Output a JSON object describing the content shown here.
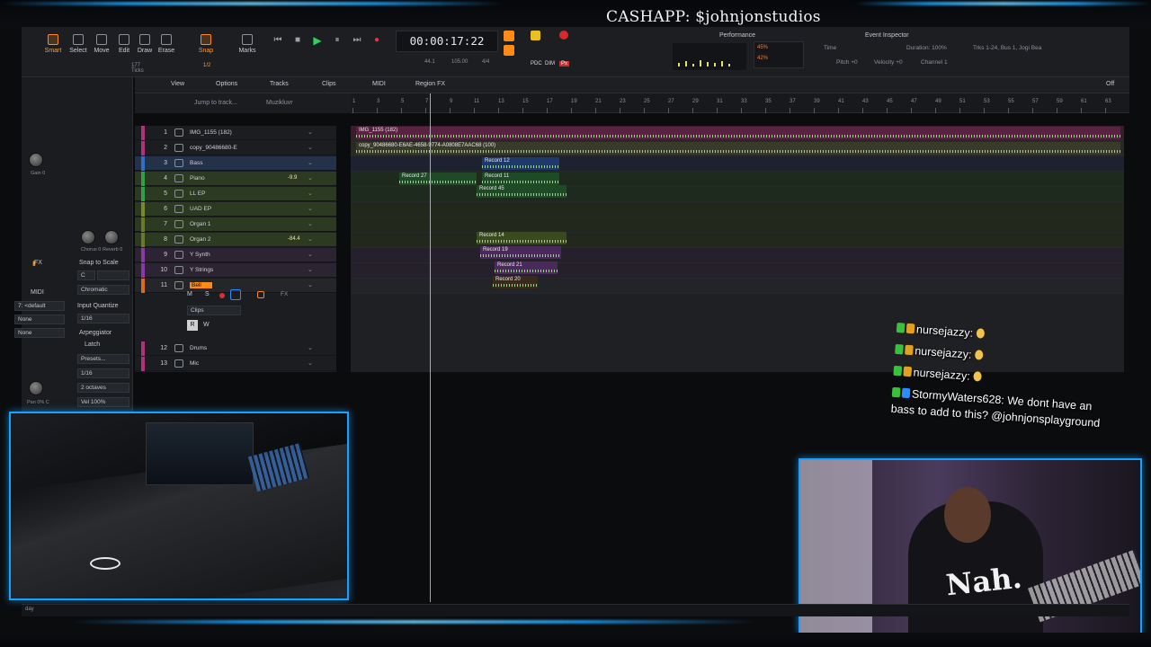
{
  "overlay": {
    "cashapp_text": "CASHAPP: $johnjonstudios"
  },
  "toolbar": {
    "tools": [
      "Smart",
      "Select",
      "Move",
      "Edit",
      "Draw",
      "Erase"
    ],
    "snap_label": "Snap",
    "snap_value": "1/2",
    "marks_label": "Marks",
    "ticks_label": "177 Ticks",
    "timecode": "00:00:17:22",
    "tempo": "105.00",
    "meter": "4/4",
    "bar_display": "44.1",
    "mode_labels": [
      "PDC",
      "DIM",
      "Px",
      "Fx"
    ],
    "performance_label": "Performance",
    "perf_values": [
      "45%",
      "42%"
    ],
    "event_inspector_label": "Event Inspector",
    "inspector_fields": [
      "Time",
      "Duration: 100%",
      "Pitch +0",
      "Velocity +0",
      "Channel 1"
    ],
    "track_info": "Trks 1-24, Bus 1, Jogi Bea"
  },
  "menu": {
    "items": [
      "View",
      "Options",
      "Tracks",
      "Clips",
      "MIDI",
      "Region FX"
    ],
    "off_label": "Off",
    "jump_placeholder": "Jump to track...",
    "workspace_label": "Muzikluvr"
  },
  "ruler_ticks": [
    "1",
    "3",
    "5",
    "7",
    "9",
    "11",
    "13",
    "15",
    "17",
    "19",
    "21",
    "23",
    "25",
    "27",
    "29",
    "31",
    "33",
    "35",
    "37",
    "39",
    "41",
    "43",
    "45",
    "47",
    "49",
    "51",
    "53",
    "55",
    "57",
    "59",
    "61",
    "63"
  ],
  "inspector": {
    "knob_label_1": "Gain 0",
    "knob_labels_2": [
      "Chorus 0",
      "Reverb 0"
    ],
    "snap_to_scale": "Snap to Scale",
    "scale_key": "C",
    "scale_type": "Chromatic",
    "midi_label": "MIDI",
    "channel_value": "7: <default",
    "none_1": "None",
    "none_2": "None",
    "input_quantize": "Input Quantize",
    "quantize_value": "1/16",
    "arpeggiator": "Arpeggiator",
    "latch": "Latch",
    "presets": "Presets...",
    "arp_rate": "1/16",
    "octaves": "2 octaves",
    "vel": "Vel  100%",
    "pan_label": "Pan 0% C",
    "fx_label": "FX"
  },
  "tracks": [
    {
      "num": "1",
      "name": "IMG_1155 (182)",
      "vol": "",
      "color": "#b3307a"
    },
    {
      "num": "2",
      "name": "copy_90486680-E",
      "vol": "",
      "color": "#b3307a"
    },
    {
      "num": "3",
      "name": "Bass",
      "vol": "",
      "color": "#2f6fc8"
    },
    {
      "num": "4",
      "name": "Piano",
      "vol": "-9.9",
      "color": "#2fa04a"
    },
    {
      "num": "5",
      "name": "LL EP",
      "vol": "",
      "color": "#2fa04a"
    },
    {
      "num": "6",
      "name": "UAD EP",
      "vol": "",
      "color": "#7a8a2a"
    },
    {
      "num": "7",
      "name": "Organ 1",
      "vol": "",
      "color": "#6b7a28"
    },
    {
      "num": "8",
      "name": "Organ 2",
      "vol": "-84.4",
      "color": "#6b7a28"
    },
    {
      "num": "9",
      "name": "Y Synth",
      "vol": "",
      "color": "#8a3aa8"
    },
    {
      "num": "10",
      "name": "Y Strings",
      "vol": "",
      "color": "#8a3aa8"
    },
    {
      "num": "11",
      "name": "Bell",
      "vol": "",
      "color": "#e06a1a"
    },
    {
      "num": "12",
      "name": "Drums",
      "vol": "",
      "color": "#b3307a"
    },
    {
      "num": "13",
      "name": "Mic",
      "vol": "",
      "color": "#b3307a"
    }
  ],
  "bell_track_controls": {
    "mute": "M",
    "solo": "S",
    "clips_dropdown": "Clips",
    "read": "R",
    "write": "W",
    "fx": "FX"
  },
  "clips": [
    {
      "label": "IMG_1155 (182)",
      "color": "#5a2240"
    },
    {
      "label": "copy_90486680-E6AE-4658-9774-A0808E7AAC68 (100)",
      "color": "#3a3a2a"
    },
    {
      "label": "Record 12",
      "color": "#1e3a6a"
    },
    {
      "label": "Record 27",
      "color": "#1f4a26"
    },
    {
      "label": "Record 11",
      "color": "#1f4a26"
    },
    {
      "label": "Record 45",
      "color": "#1f4a26"
    },
    {
      "label": "Record 14",
      "color": "#3a4a1e"
    },
    {
      "label": "Record 19",
      "color": "#4a2a5a"
    },
    {
      "label": "Record 21",
      "color": "#4a2a5a"
    },
    {
      "label": "Record 20",
      "color": "#3a2a1e"
    }
  ],
  "chat": [
    {
      "user": "nursejazzy:",
      "msg": "",
      "color": "#ffb24a"
    },
    {
      "user": "nursejazzy:",
      "msg": "",
      "color": "#ffb24a"
    },
    {
      "user": "nursejazzy:",
      "msg": "",
      "color": "#ffb24a"
    },
    {
      "user": "StormyWaters628:",
      "msg": "We dont have an",
      "color": "#2a8cff"
    }
  ],
  "chat_continuation": "bass to add to this? @johnjonsplayground",
  "webcam": {
    "shirt_text": "Nah."
  },
  "statusbar": {
    "left": "day"
  }
}
